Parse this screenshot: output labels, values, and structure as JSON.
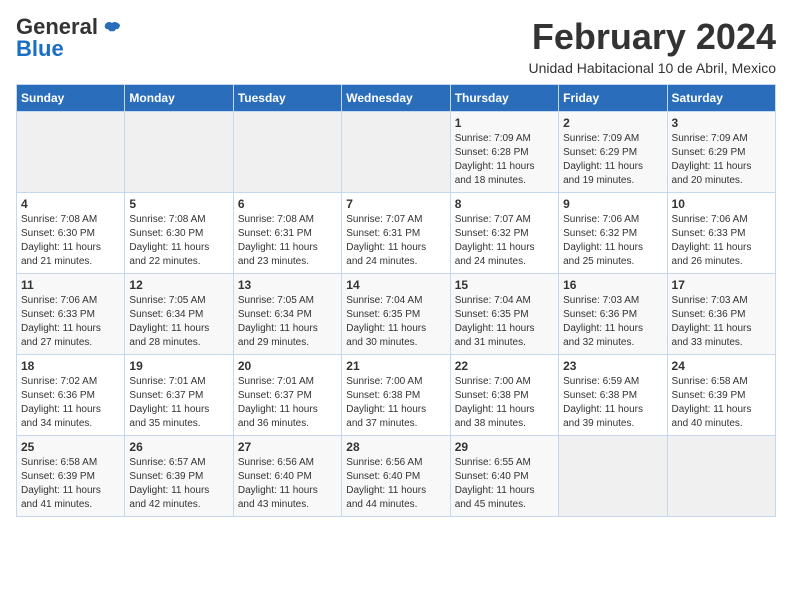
{
  "header": {
    "logo_general": "General",
    "logo_blue": "Blue",
    "title": "February 2024",
    "subtitle": "Unidad Habitacional 10 de Abril, Mexico"
  },
  "weekdays": [
    "Sunday",
    "Monday",
    "Tuesday",
    "Wednesday",
    "Thursday",
    "Friday",
    "Saturday"
  ],
  "weeks": [
    [
      {
        "day": "",
        "info": ""
      },
      {
        "day": "",
        "info": ""
      },
      {
        "day": "",
        "info": ""
      },
      {
        "day": "",
        "info": ""
      },
      {
        "day": "1",
        "info": "Sunrise: 7:09 AM\nSunset: 6:28 PM\nDaylight: 11 hours\nand 18 minutes."
      },
      {
        "day": "2",
        "info": "Sunrise: 7:09 AM\nSunset: 6:29 PM\nDaylight: 11 hours\nand 19 minutes."
      },
      {
        "day": "3",
        "info": "Sunrise: 7:09 AM\nSunset: 6:29 PM\nDaylight: 11 hours\nand 20 minutes."
      }
    ],
    [
      {
        "day": "4",
        "info": "Sunrise: 7:08 AM\nSunset: 6:30 PM\nDaylight: 11 hours\nand 21 minutes."
      },
      {
        "day": "5",
        "info": "Sunrise: 7:08 AM\nSunset: 6:30 PM\nDaylight: 11 hours\nand 22 minutes."
      },
      {
        "day": "6",
        "info": "Sunrise: 7:08 AM\nSunset: 6:31 PM\nDaylight: 11 hours\nand 23 minutes."
      },
      {
        "day": "7",
        "info": "Sunrise: 7:07 AM\nSunset: 6:31 PM\nDaylight: 11 hours\nand 24 minutes."
      },
      {
        "day": "8",
        "info": "Sunrise: 7:07 AM\nSunset: 6:32 PM\nDaylight: 11 hours\nand 24 minutes."
      },
      {
        "day": "9",
        "info": "Sunrise: 7:06 AM\nSunset: 6:32 PM\nDaylight: 11 hours\nand 25 minutes."
      },
      {
        "day": "10",
        "info": "Sunrise: 7:06 AM\nSunset: 6:33 PM\nDaylight: 11 hours\nand 26 minutes."
      }
    ],
    [
      {
        "day": "11",
        "info": "Sunrise: 7:06 AM\nSunset: 6:33 PM\nDaylight: 11 hours\nand 27 minutes."
      },
      {
        "day": "12",
        "info": "Sunrise: 7:05 AM\nSunset: 6:34 PM\nDaylight: 11 hours\nand 28 minutes."
      },
      {
        "day": "13",
        "info": "Sunrise: 7:05 AM\nSunset: 6:34 PM\nDaylight: 11 hours\nand 29 minutes."
      },
      {
        "day": "14",
        "info": "Sunrise: 7:04 AM\nSunset: 6:35 PM\nDaylight: 11 hours\nand 30 minutes."
      },
      {
        "day": "15",
        "info": "Sunrise: 7:04 AM\nSunset: 6:35 PM\nDaylight: 11 hours\nand 31 minutes."
      },
      {
        "day": "16",
        "info": "Sunrise: 7:03 AM\nSunset: 6:36 PM\nDaylight: 11 hours\nand 32 minutes."
      },
      {
        "day": "17",
        "info": "Sunrise: 7:03 AM\nSunset: 6:36 PM\nDaylight: 11 hours\nand 33 minutes."
      }
    ],
    [
      {
        "day": "18",
        "info": "Sunrise: 7:02 AM\nSunset: 6:36 PM\nDaylight: 11 hours\nand 34 minutes."
      },
      {
        "day": "19",
        "info": "Sunrise: 7:01 AM\nSunset: 6:37 PM\nDaylight: 11 hours\nand 35 minutes."
      },
      {
        "day": "20",
        "info": "Sunrise: 7:01 AM\nSunset: 6:37 PM\nDaylight: 11 hours\nand 36 minutes."
      },
      {
        "day": "21",
        "info": "Sunrise: 7:00 AM\nSunset: 6:38 PM\nDaylight: 11 hours\nand 37 minutes."
      },
      {
        "day": "22",
        "info": "Sunrise: 7:00 AM\nSunset: 6:38 PM\nDaylight: 11 hours\nand 38 minutes."
      },
      {
        "day": "23",
        "info": "Sunrise: 6:59 AM\nSunset: 6:38 PM\nDaylight: 11 hours\nand 39 minutes."
      },
      {
        "day": "24",
        "info": "Sunrise: 6:58 AM\nSunset: 6:39 PM\nDaylight: 11 hours\nand 40 minutes."
      }
    ],
    [
      {
        "day": "25",
        "info": "Sunrise: 6:58 AM\nSunset: 6:39 PM\nDaylight: 11 hours\nand 41 minutes."
      },
      {
        "day": "26",
        "info": "Sunrise: 6:57 AM\nSunset: 6:39 PM\nDaylight: 11 hours\nand 42 minutes."
      },
      {
        "day": "27",
        "info": "Sunrise: 6:56 AM\nSunset: 6:40 PM\nDaylight: 11 hours\nand 43 minutes."
      },
      {
        "day": "28",
        "info": "Sunrise: 6:56 AM\nSunset: 6:40 PM\nDaylight: 11 hours\nand 44 minutes."
      },
      {
        "day": "29",
        "info": "Sunrise: 6:55 AM\nSunset: 6:40 PM\nDaylight: 11 hours\nand 45 minutes."
      },
      {
        "day": "",
        "info": ""
      },
      {
        "day": "",
        "info": ""
      }
    ]
  ]
}
